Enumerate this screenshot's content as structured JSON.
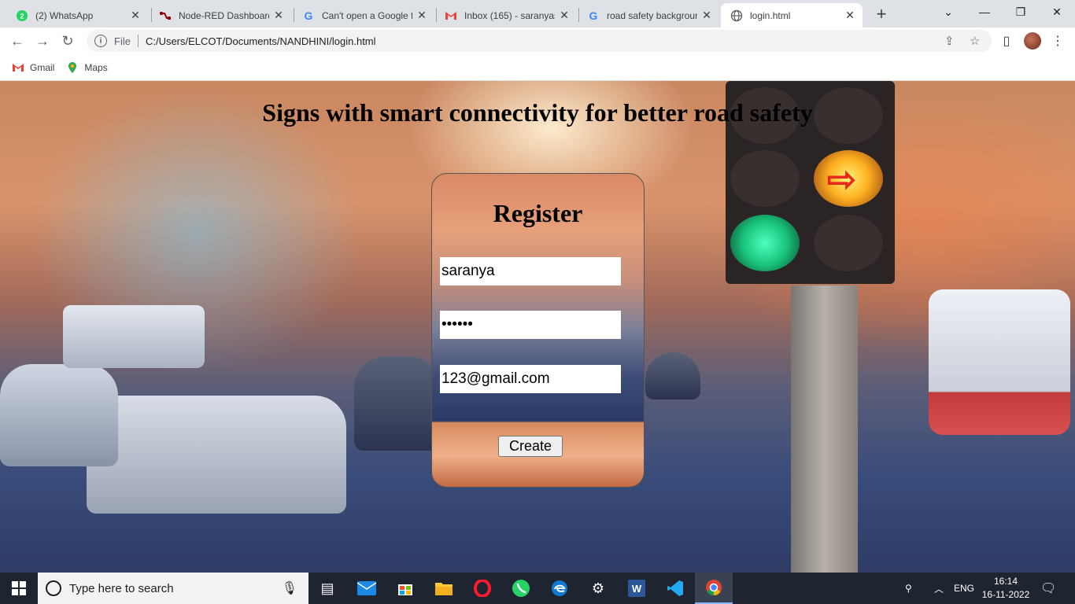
{
  "browser": {
    "tabs": [
      {
        "label": "(2) WhatsApp",
        "icon": "whatsapp-icon"
      },
      {
        "label": "Node-RED Dashboard",
        "icon": "node-red-icon"
      },
      {
        "label": "Can't open a Google f",
        "icon": "google-icon"
      },
      {
        "label": "Inbox (165) - saranyas",
        "icon": "gmail-icon"
      },
      {
        "label": "road safety backgroun",
        "icon": "google-icon"
      },
      {
        "label": "login.html",
        "icon": "globe-icon",
        "active": true
      }
    ],
    "address": {
      "scheme_label": "File",
      "url": "C:/Users/ELCOT/Documents/NANDHINI/login.html"
    },
    "bookmarks": [
      {
        "label": "Gmail",
        "icon": "gmail-icon"
      },
      {
        "label": "Maps",
        "icon": "maps-icon"
      }
    ]
  },
  "page": {
    "heading": "Signs with smart connectivity for better road safety",
    "form": {
      "title": "Register",
      "username_value": "saranya",
      "password_value": "••••••",
      "email_value": "123@gmail.com",
      "create_label": "Create"
    }
  },
  "taskbar": {
    "search_placeholder": "Type here to search",
    "language": "ENG",
    "time": "16:14",
    "date": "16-11-2022"
  },
  "colors": {
    "accent_green": "#25d366",
    "chrome_tab_bg": "#dee1e6",
    "taskbar_bg": "#1f2530"
  }
}
